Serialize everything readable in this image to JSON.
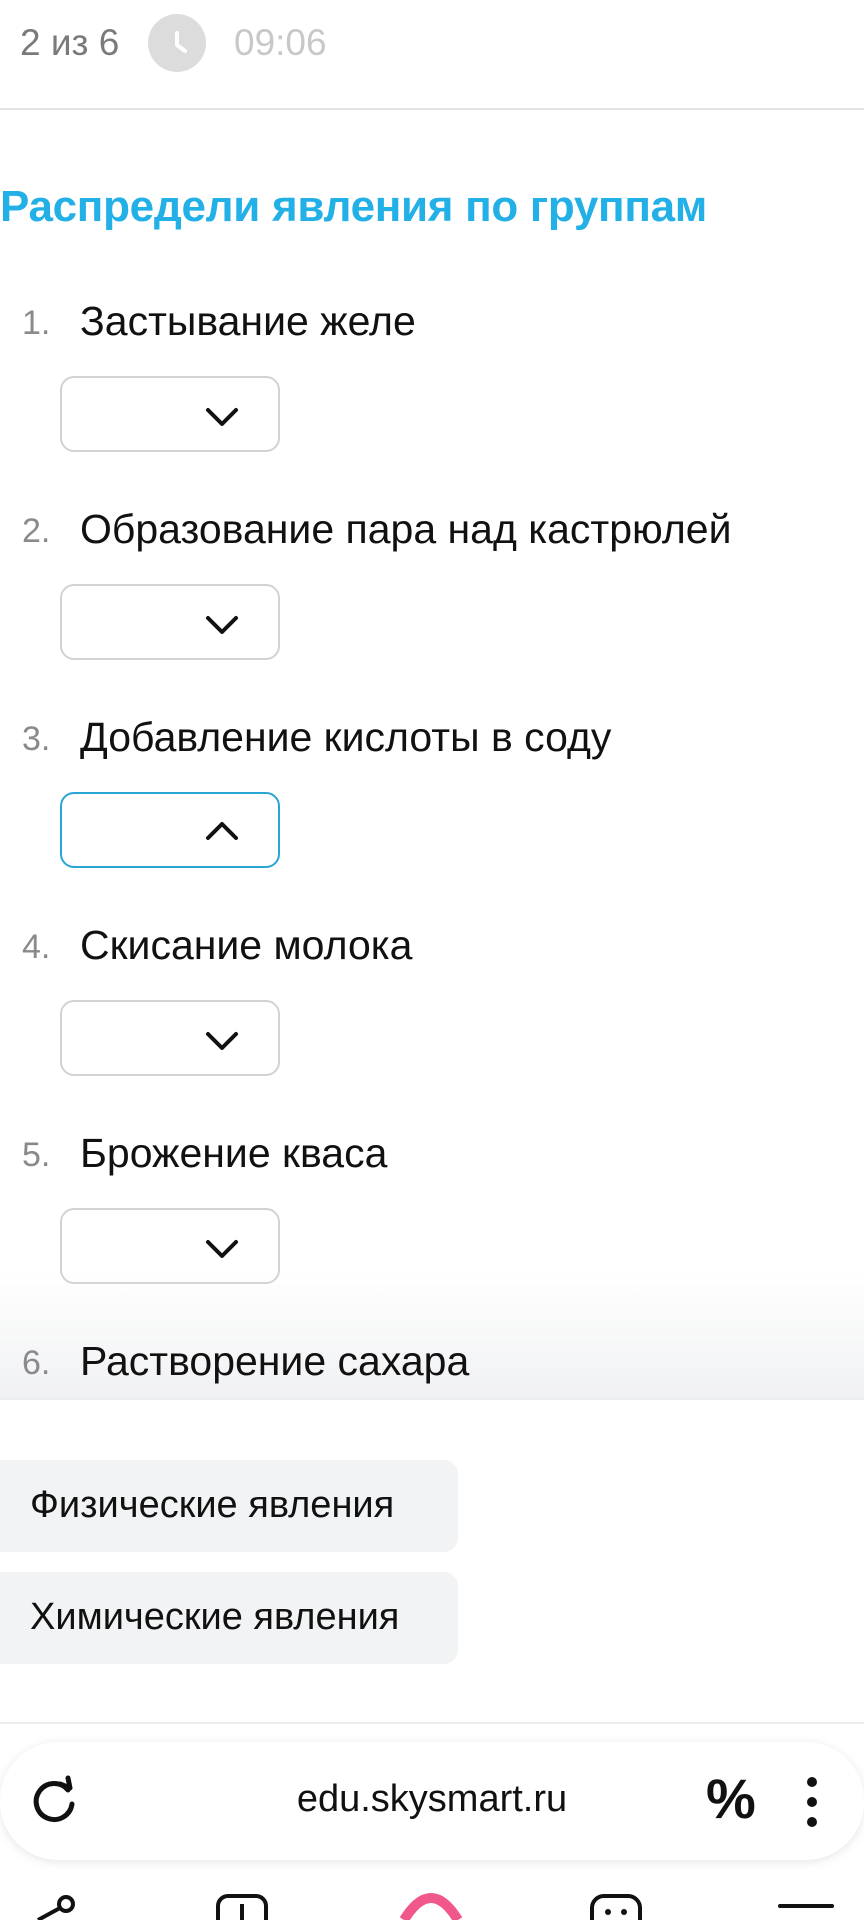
{
  "topbar": {
    "progress": "2 из 6",
    "timer": "09:06"
  },
  "title": "Распредели явления по группам",
  "questions": [
    {
      "num": "1.",
      "text": "Застывание желе",
      "state": "closed"
    },
    {
      "num": "2.",
      "text": "Образование пара над кастрюлей",
      "state": "closed"
    },
    {
      "num": "3.",
      "text": "Добавление кислоты в соду",
      "state": "open"
    },
    {
      "num": "4.",
      "text": "Скисание молока",
      "state": "closed"
    },
    {
      "num": "5.",
      "text": "Брожение кваса",
      "state": "closed"
    },
    {
      "num": "6.",
      "text": "Растворение сахара",
      "state": "closed"
    }
  ],
  "options": [
    {
      "label": "Физические явления"
    },
    {
      "label": "Химические явления"
    }
  ],
  "browser": {
    "url": "edu.skysmart.ru",
    "percent": "%"
  },
  "colors": {
    "accent": "#22b0e6",
    "open_border": "#2aa6d6",
    "option_bg": "#f2f3f5",
    "nav_accent": "#f0588c"
  }
}
